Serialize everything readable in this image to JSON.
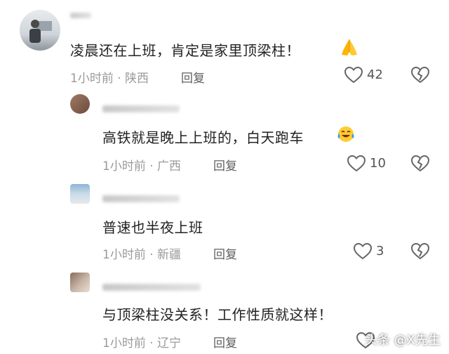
{
  "comments": [
    {
      "text": "凌晨还在上班，肯定是家里顶梁柱！",
      "time": "1小时前",
      "location": "陕西",
      "reply_label": "回复",
      "likes": "42",
      "emoji": "folded-hands"
    },
    {
      "text": "高铁就是晚上上班的，白天跑车",
      "time": "1小时前",
      "location": "广西",
      "reply_label": "回复",
      "likes": "10",
      "emoji": "tears-of-joy"
    },
    {
      "text": "普速也半夜上班",
      "time": "1小时前",
      "location": "新疆",
      "reply_label": "回复",
      "likes": "3"
    },
    {
      "text": "与顶梁柱没关系！工作性质就这样！",
      "time": "1小时前",
      "location": "辽宁",
      "reply_label": "回复",
      "likes": ""
    }
  ],
  "separator": " · ",
  "watermark": "头条 @X先生",
  "colors": {
    "text": "#222222",
    "meta": "#9a9a9a",
    "icon": "#666666"
  }
}
